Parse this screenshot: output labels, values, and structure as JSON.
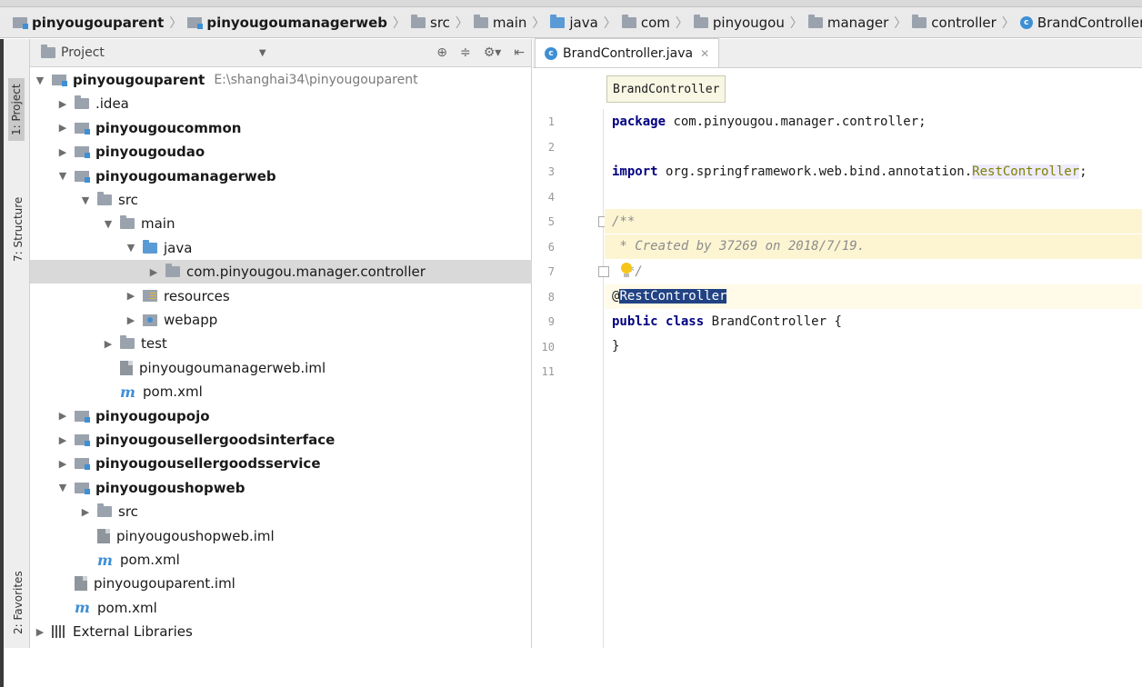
{
  "navbar": {
    "crumbs": [
      {
        "label": "pinyougouparent",
        "bold": true,
        "icon": "module-icon"
      },
      {
        "label": "pinyougoumanagerweb",
        "bold": true,
        "icon": "module-icon"
      },
      {
        "label": "src",
        "icon": "folder-icon"
      },
      {
        "label": "main",
        "icon": "folder-icon"
      },
      {
        "label": "java",
        "icon": "folder-icon"
      },
      {
        "label": "com",
        "icon": "package-icon"
      },
      {
        "label": "pinyougou",
        "icon": "package-icon"
      },
      {
        "label": "manager",
        "icon": "package-icon"
      },
      {
        "label": "controller",
        "icon": "package-icon"
      },
      {
        "label": "BrandController",
        "icon": "class-icon"
      }
    ]
  },
  "sidebar_tabs": {
    "project": "1: Project",
    "structure": "7: Structure",
    "favorites": "2: Favorites"
  },
  "project_panel": {
    "title": "Project",
    "tree": [
      {
        "label": "pinyougouparent",
        "path": "E:\\shanghai34\\pinyougouparent",
        "bold": true,
        "indent": 0,
        "arrow": "down",
        "icon": "module"
      },
      {
        "label": ".idea",
        "indent": 1,
        "arrow": "right",
        "icon": "folder"
      },
      {
        "label": "pinyougoucommon",
        "bold": true,
        "indent": 1,
        "arrow": "right",
        "icon": "module"
      },
      {
        "label": "pinyougoudao",
        "bold": true,
        "indent": 1,
        "arrow": "right",
        "icon": "module"
      },
      {
        "label": "pinyougoumanagerweb",
        "bold": true,
        "indent": 1,
        "arrow": "down",
        "icon": "module"
      },
      {
        "label": "src",
        "indent": 2,
        "arrow": "down",
        "icon": "folder"
      },
      {
        "label": "main",
        "indent": 3,
        "arrow": "down",
        "icon": "folder"
      },
      {
        "label": "java",
        "indent": 4,
        "arrow": "down",
        "icon": "folder-blue"
      },
      {
        "label": "com.pinyougou.manager.controller",
        "indent": 5,
        "arrow": "right",
        "icon": "package",
        "selected": true
      },
      {
        "label": "resources",
        "indent": 4,
        "arrow": "right",
        "icon": "resources"
      },
      {
        "label": "webapp",
        "indent": 4,
        "arrow": "right",
        "icon": "web"
      },
      {
        "label": "test",
        "indent": 3,
        "arrow": "right",
        "icon": "folder"
      },
      {
        "label": "pinyougoumanagerweb.iml",
        "indent": 3,
        "arrow": "",
        "icon": "file"
      },
      {
        "label": "pom.xml",
        "indent": 3,
        "arrow": "",
        "icon": "maven"
      },
      {
        "label": "pinyougoupojo",
        "bold": true,
        "indent": 1,
        "arrow": "right",
        "icon": "module"
      },
      {
        "label": "pinyougousellergoodsinterface",
        "bold": true,
        "indent": 1,
        "arrow": "right",
        "icon": "module"
      },
      {
        "label": "pinyougousellergoodsservice",
        "bold": true,
        "indent": 1,
        "arrow": "right",
        "icon": "module"
      },
      {
        "label": "pinyougoushopweb",
        "bold": true,
        "indent": 1,
        "arrow": "down",
        "icon": "module"
      },
      {
        "label": "src",
        "indent": 2,
        "arrow": "right",
        "icon": "folder"
      },
      {
        "label": "pinyougoushopweb.iml",
        "indent": 2,
        "arrow": "",
        "icon": "file"
      },
      {
        "label": "pom.xml",
        "indent": 2,
        "arrow": "",
        "icon": "maven"
      },
      {
        "label": "pinyougouparent.iml",
        "indent": 1,
        "arrow": "",
        "icon": "file"
      },
      {
        "label": "pom.xml",
        "indent": 1,
        "arrow": "",
        "icon": "maven"
      },
      {
        "label": "External Libraries",
        "indent": 0,
        "arrow": "right",
        "icon": "library"
      }
    ]
  },
  "editor": {
    "tab_label": "BrandController.java",
    "breadcrumb_hint": "BrandController",
    "lines": [
      {
        "n": "1",
        "parts": [
          {
            "t": "package",
            "c": "kw"
          },
          {
            "t": " com.pinyougou.manager.controller;"
          }
        ]
      },
      {
        "n": "2",
        "parts": []
      },
      {
        "n": "3",
        "parts": [
          {
            "t": "import",
            "c": "kw"
          },
          {
            "t": " org.springframework.web.bind.annotation."
          },
          {
            "t": "RestController",
            "c": "hl"
          },
          {
            "t": ";"
          }
        ]
      },
      {
        "n": "4",
        "parts": []
      },
      {
        "n": "5",
        "parts": [
          {
            "t": "/**",
            "c": "cm"
          }
        ],
        "doc": true
      },
      {
        "n": "6",
        "parts": [
          {
            "t": " * Created by 37269 on 2018/7/19.",
            "c": "cm"
          }
        ],
        "doc": true
      },
      {
        "n": "7",
        "parts": [
          {
            "t": "  */",
            "c": "cm"
          }
        ]
      },
      {
        "n": "8",
        "parts": [
          {
            "t": "@"
          },
          {
            "t": "RestController",
            "c": "selA"
          }
        ],
        "cur": true
      },
      {
        "n": "9",
        "parts": [
          {
            "t": "public",
            "c": "kw"
          },
          {
            "t": " "
          },
          {
            "t": "class",
            "c": "kw"
          },
          {
            "t": " BrandController {"
          }
        ]
      },
      {
        "n": "10",
        "parts": [
          {
            "t": "}"
          }
        ]
      },
      {
        "n": "11",
        "parts": []
      }
    ]
  }
}
